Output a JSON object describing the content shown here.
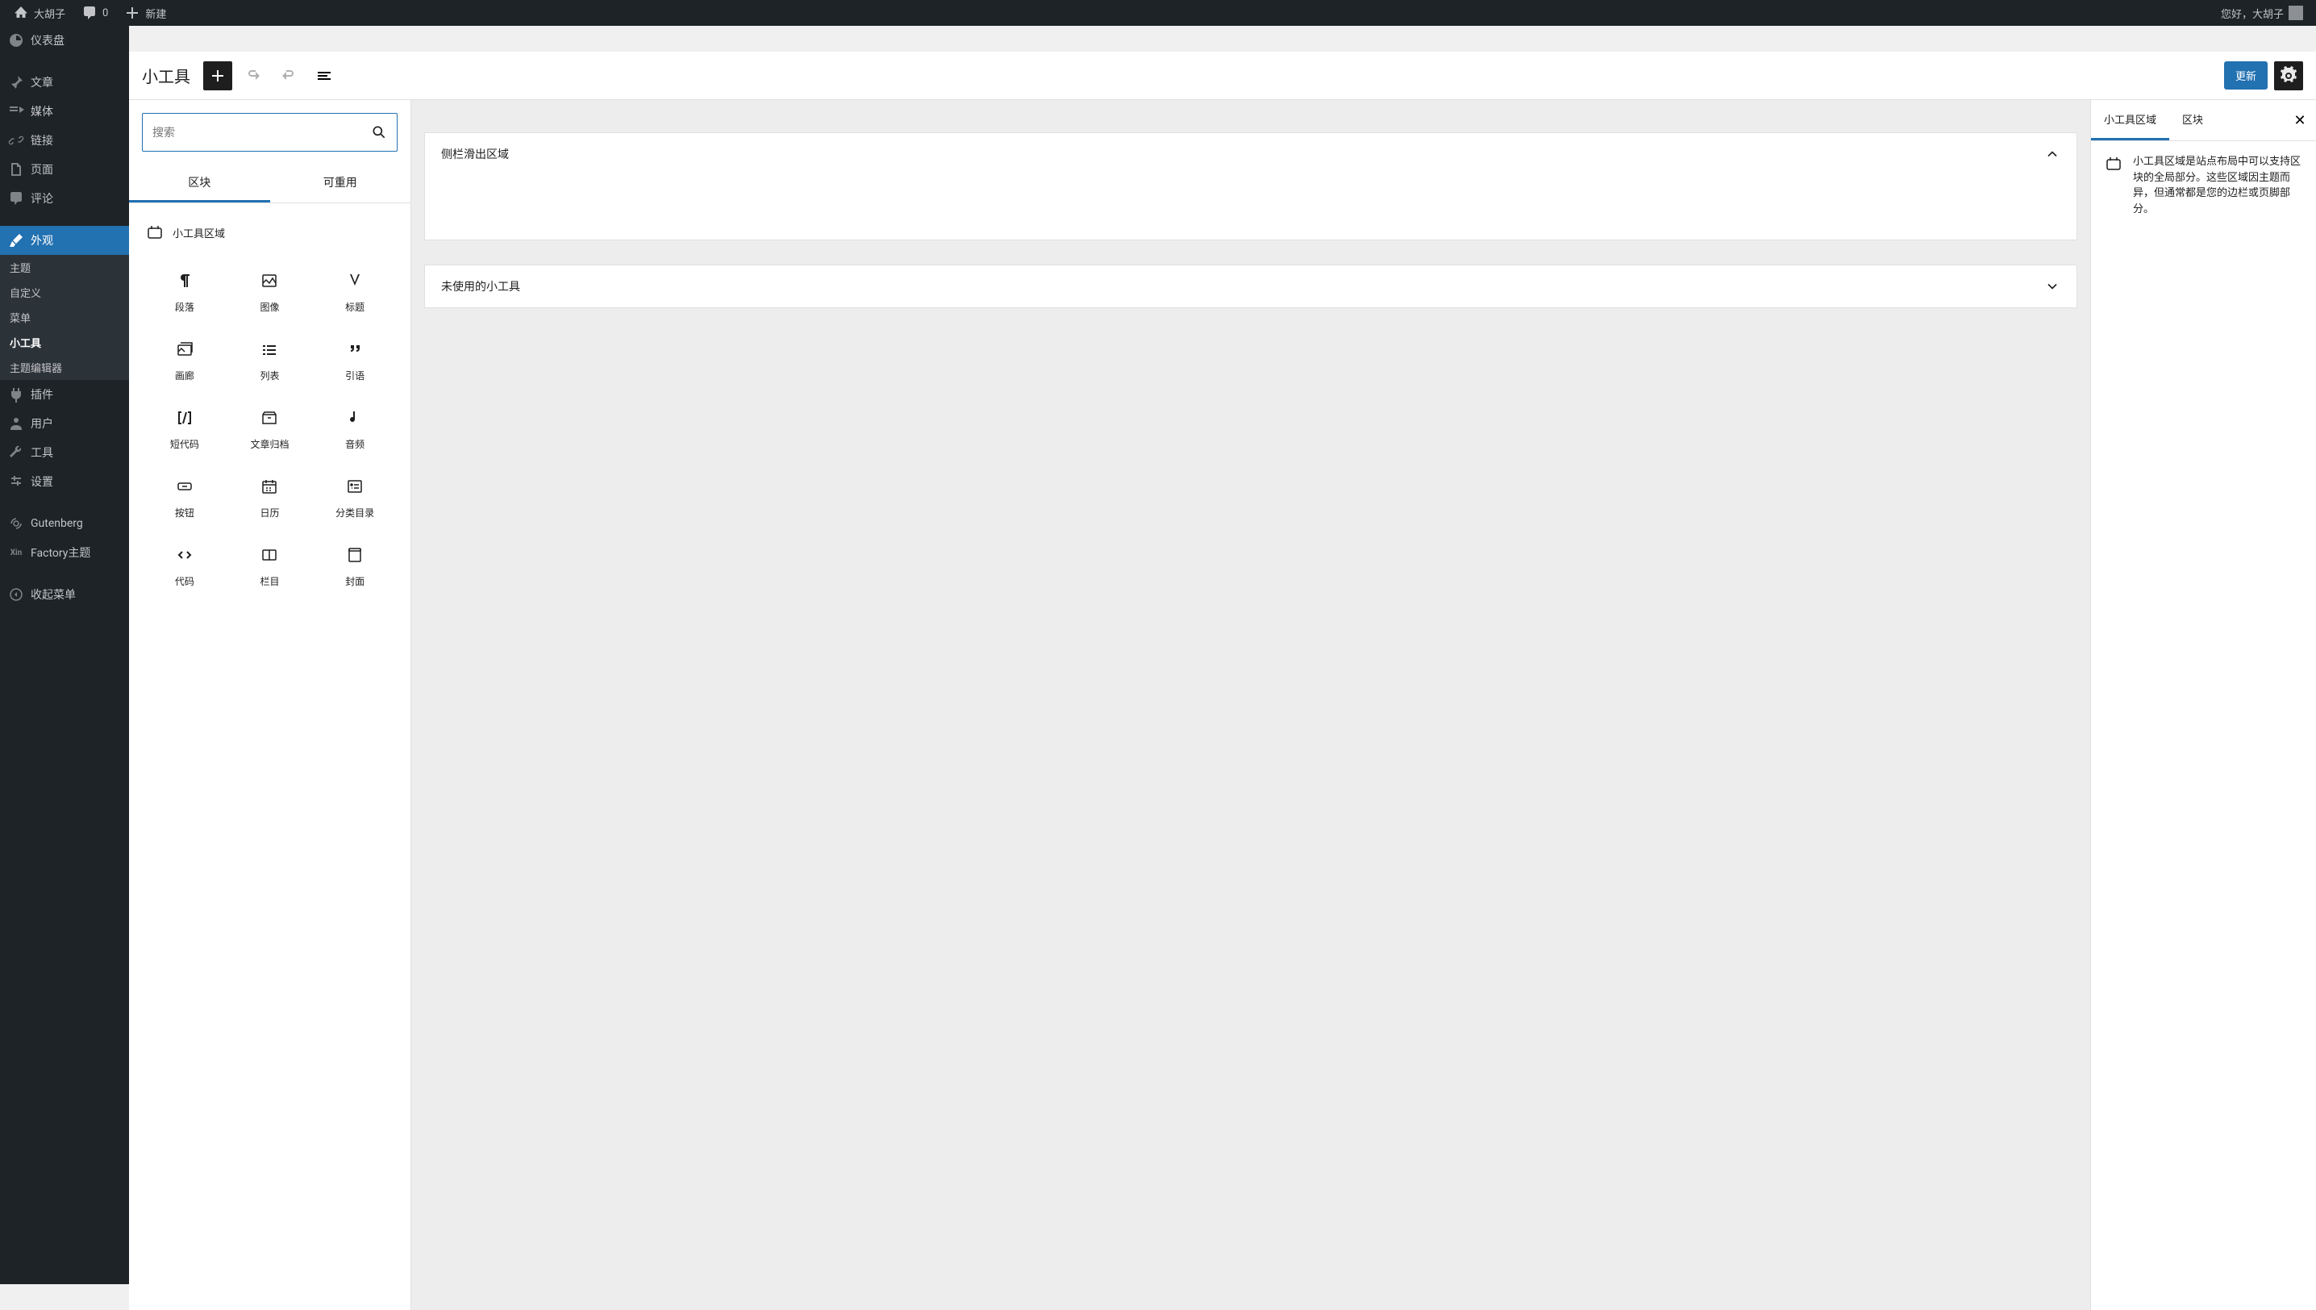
{
  "adminbar": {
    "site_name": "大胡子",
    "comments_count": "0",
    "new_label": "新建",
    "greeting": "您好，大胡子"
  },
  "sidebar": {
    "items": [
      {
        "label": "仪表盘",
        "icon": "dashboard"
      },
      {
        "label": "文章",
        "icon": "pin"
      },
      {
        "label": "媒体",
        "icon": "media"
      },
      {
        "label": "链接",
        "icon": "link"
      },
      {
        "label": "页面",
        "icon": "page"
      },
      {
        "label": "评论",
        "icon": "comment"
      },
      {
        "label": "外观",
        "icon": "brush",
        "active": true
      },
      {
        "label": "插件",
        "icon": "plugin"
      },
      {
        "label": "用户",
        "icon": "user"
      },
      {
        "label": "工具",
        "icon": "wrench"
      },
      {
        "label": "设置",
        "icon": "settings"
      },
      {
        "label": "Gutenberg",
        "icon": "gutenberg"
      },
      {
        "label": "Factory主题",
        "icon": "xin"
      },
      {
        "label": "收起菜单",
        "icon": "collapse"
      }
    ],
    "submenu": [
      {
        "label": "主题"
      },
      {
        "label": "自定义"
      },
      {
        "label": "菜单"
      },
      {
        "label": "小工具",
        "active": true
      },
      {
        "label": "主题编辑器"
      }
    ]
  },
  "editor": {
    "title": "小工具",
    "update_label": "更新"
  },
  "inserter": {
    "search_placeholder": "搜索",
    "tabs": [
      {
        "label": "区块",
        "active": true
      },
      {
        "label": "可重用"
      }
    ],
    "category": "小工具区域",
    "blocks": [
      {
        "label": "段落",
        "icon": "paragraph"
      },
      {
        "label": "图像",
        "icon": "image"
      },
      {
        "label": "标题",
        "icon": "heading"
      },
      {
        "label": "画廊",
        "icon": "gallery"
      },
      {
        "label": "列表",
        "icon": "list"
      },
      {
        "label": "引语",
        "icon": "quote"
      },
      {
        "label": "短代码",
        "icon": "shortcode"
      },
      {
        "label": "文章归档",
        "icon": "archive"
      },
      {
        "label": "音频",
        "icon": "audio"
      },
      {
        "label": "按钮",
        "icon": "button"
      },
      {
        "label": "日历",
        "icon": "calendar"
      },
      {
        "label": "分类目录",
        "icon": "categories"
      },
      {
        "label": "代码",
        "icon": "code"
      },
      {
        "label": "栏目",
        "icon": "columns"
      },
      {
        "label": "封面",
        "icon": "cover"
      }
    ]
  },
  "canvas": {
    "areas": [
      {
        "title": "侧栏滑出区域",
        "expanded": true
      },
      {
        "title": "未使用的小工具",
        "expanded": false
      }
    ]
  },
  "right_panel": {
    "tabs": [
      {
        "label": "小工具区域",
        "active": true
      },
      {
        "label": "区块"
      }
    ],
    "description": "小工具区域是站点布局中可以支持区块的全局部分。这些区域因主题而异，但通常都是您的边栏或页脚部分。"
  }
}
